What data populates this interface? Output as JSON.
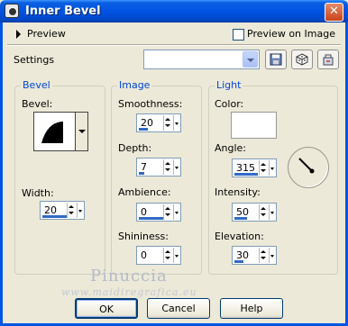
{
  "window": {
    "title": "Inner Bevel",
    "close_symbol": "✕"
  },
  "preview": {
    "label": "Preview",
    "checkbox_label": "Preview on Image",
    "checked": false
  },
  "settings": {
    "label": "Settings",
    "value": ""
  },
  "bevel_group": {
    "title": "Bevel",
    "bevel_label": "Bevel:",
    "width_label": "Width:",
    "width_value": "20"
  },
  "image_group": {
    "title": "Image",
    "smoothness_label": "Smoothness:",
    "smoothness_value": "20",
    "depth_label": "Depth:",
    "depth_value": "7",
    "ambience_label": "Ambience:",
    "ambience_value": "0",
    "shininess_label": "Shininess:",
    "shininess_value": "0"
  },
  "light_group": {
    "title": "Light",
    "color_label": "Color:",
    "color_value": "#ffffff",
    "angle_label": "Angle:",
    "angle_value": "315",
    "intensity_label": "Intensity:",
    "intensity_value": "50",
    "elevation_label": "Elevation:",
    "elevation_value": "30"
  },
  "watermark": {
    "line1": "Pinuccia",
    "line2": "www.maidiregrafica.eu"
  },
  "buttons": {
    "ok": "OK",
    "cancel": "Cancel",
    "help": "Help"
  }
}
